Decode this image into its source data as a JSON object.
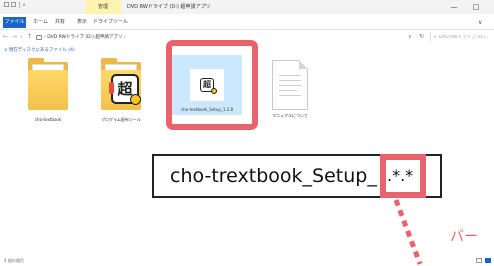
{
  "window": {
    "manage_tab": "管理",
    "title": "DVD RWドライブ (D:) 超申請アプリ",
    "minimize_glyph": "—",
    "maximize_glyph": "□"
  },
  "ribbon": {
    "tabs": {
      "file": "ファイル",
      "home": "ホーム",
      "share": "共有",
      "view": "表示",
      "drive_tools": "ドライブツール"
    },
    "expand_glyph": "∨"
  },
  "address": {
    "back_glyph": "←",
    "forward_glyph": "→",
    "recent_glyph": "∨",
    "up_glyph": "↑",
    "breadcrumb": "›  DVD RWドライブ (D:) 超申請アプリ  ›",
    "dropdown_glyph": "∨",
    "refresh_glyph": "↻",
    "search_placeholder": "DVD RWドライブ (D:)...",
    "search_glyph": "⌕"
  },
  "content": {
    "group_header": "∨ 現在ディスクにあるファイル (4)",
    "files": [
      {
        "label": "cho-textbook",
        "icon": "folder-icon"
      },
      {
        "label": "プログラム配布ツール",
        "icon": "app-folder-icon"
      },
      {
        "label": "cho-textbook_Setup_1.2.8",
        "icon": "setup-icon"
      },
      {
        "label": "マニュアルについて",
        "icon": "document-icon"
      }
    ]
  },
  "callout": {
    "filename": "cho-trextbook_Setup_",
    "extension": ".*.*"
  },
  "side_note": "バー",
  "status": {
    "item_count": "4 個の項目"
  },
  "colors": {
    "highlight": "#e8636b",
    "accent": "#1a63c8",
    "selection": "#cce8ff",
    "folder": "#f2c14a"
  }
}
